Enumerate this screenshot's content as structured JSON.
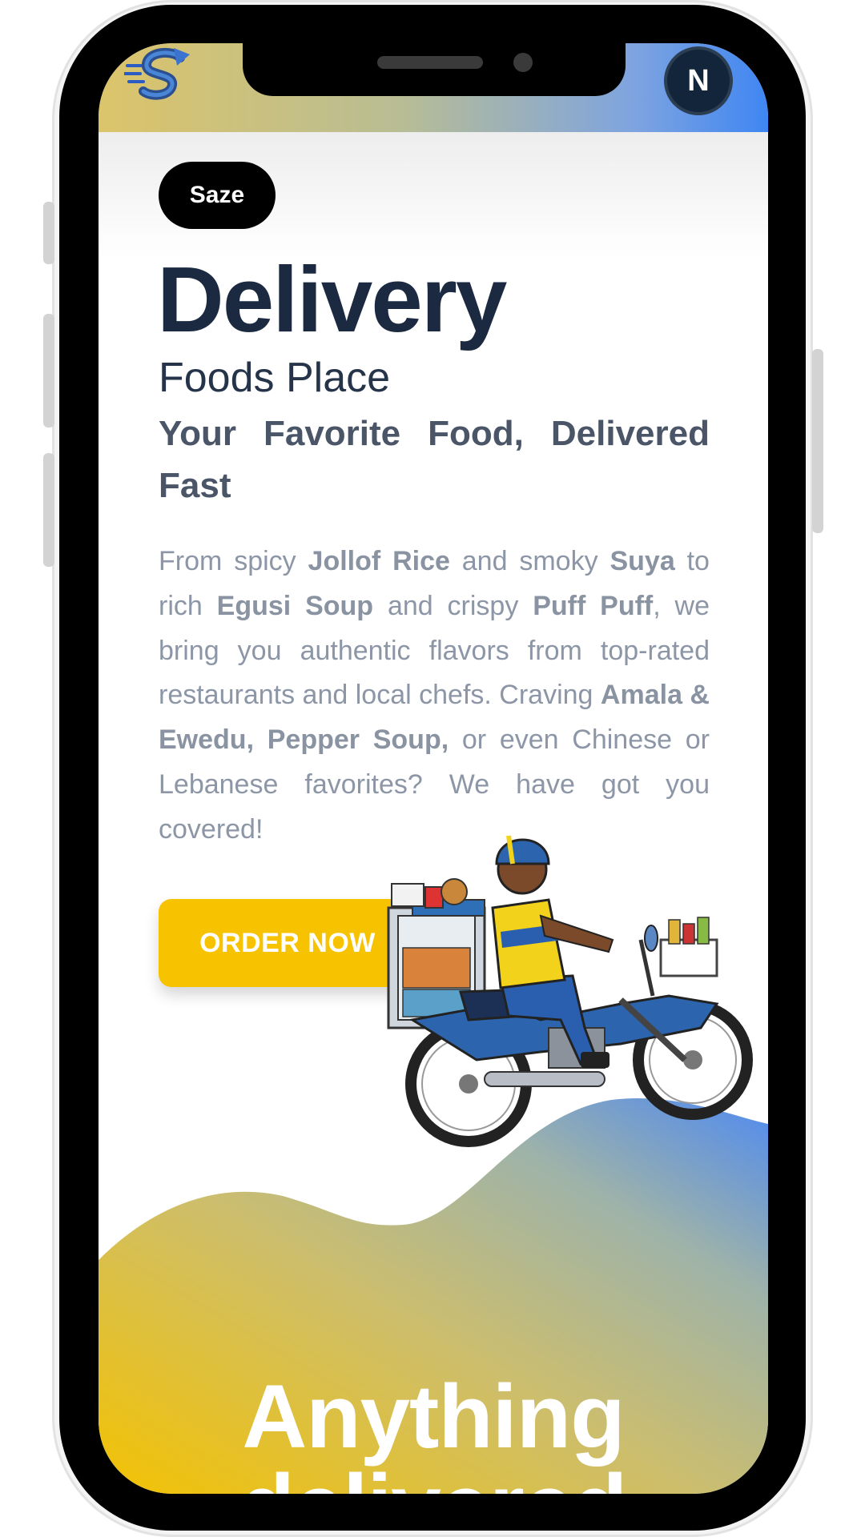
{
  "header": {
    "logo_icon": "s-logo-icon",
    "avatar_letter": "N"
  },
  "hero": {
    "badge": "Saze",
    "title": "Delivery",
    "subtitle": "Foods Place",
    "tagline": "Your Favorite Food, Delivered Fast",
    "description": {
      "t1": "From spicy ",
      "b1": "Jollof Rice",
      "t2": " and smoky ",
      "b2": "Suya",
      "t3": " to rich ",
      "b3": "Egusi Soup",
      "t4": " and crispy ",
      "b4": "Puff Puff",
      "t5": ", we bring you authentic flavors from top-rated restaurants and local chefs. Craving ",
      "b5": "Amala & Ewedu, Pepper Soup,",
      "t6": " or even Chinese or Lebanese favorites? We have got you covered!"
    },
    "cta": "ORDER NOW",
    "illustration": "delivery-rider-illustration"
  },
  "section": {
    "heading_line1": "Anything",
    "heading_line2": "delivered"
  },
  "colors": {
    "accent_yellow": "#f7c300",
    "accent_blue": "#3f86f2",
    "title_navy": "#1b2a40"
  }
}
